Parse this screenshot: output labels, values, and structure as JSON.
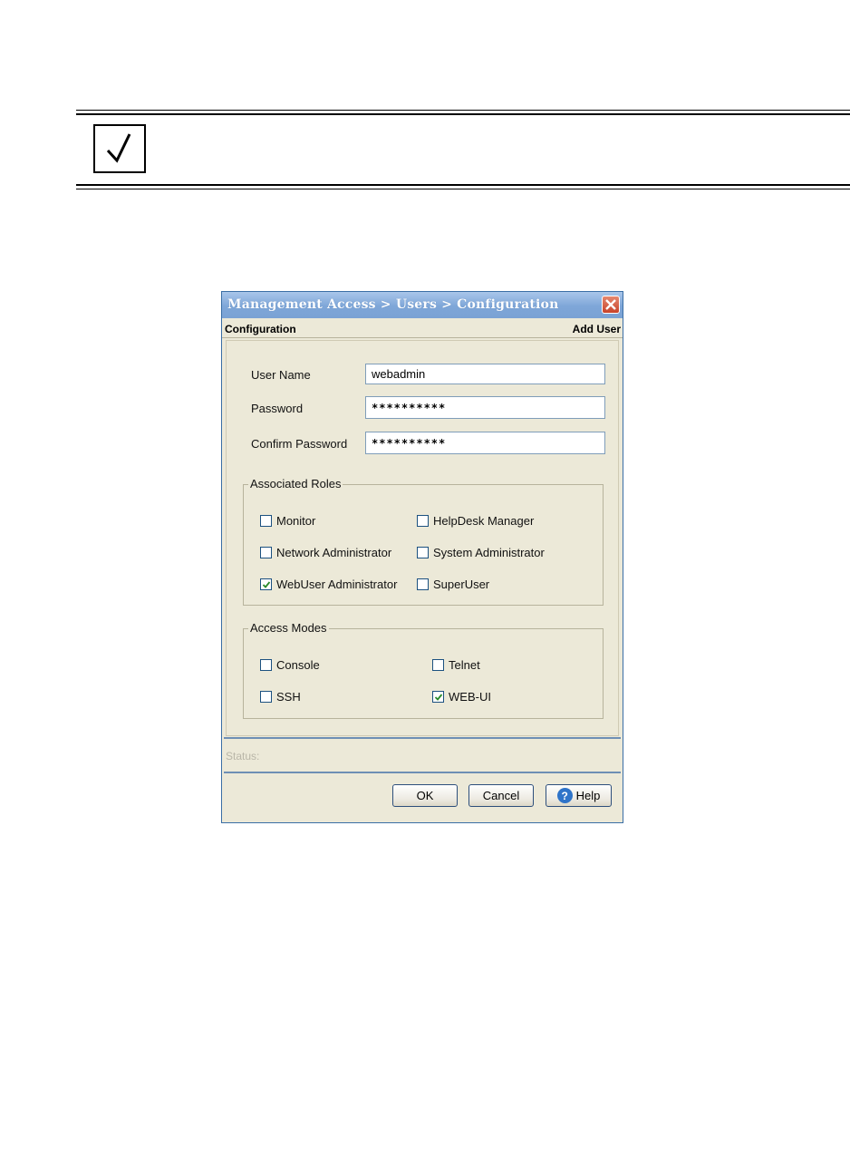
{
  "note": {
    "icon": "checkmark-icon"
  },
  "dialog": {
    "title": "Management Access > Users > Configuration",
    "header_left": "Configuration",
    "header_right": "Add User",
    "fields": {
      "username": {
        "label": "User Name",
        "value": "webadmin"
      },
      "password": {
        "label": "Password",
        "value": "**********"
      },
      "confirm": {
        "label": "Confirm Password",
        "value": "**********"
      }
    },
    "roles": {
      "title": "Associated Roles",
      "monitor": {
        "label": "Monitor",
        "checked": false
      },
      "helpdesk": {
        "label": "HelpDesk Manager",
        "checked": false
      },
      "netadmin": {
        "label": "Network Administrator",
        "checked": false
      },
      "sysadmin": {
        "label": "System Administrator",
        "checked": false
      },
      "webuser": {
        "label": "WebUser Administrator",
        "checked": true
      },
      "superuser": {
        "label": "SuperUser",
        "checked": false
      }
    },
    "modes": {
      "title": "Access Modes",
      "console": {
        "label": "Console",
        "checked": false
      },
      "telnet": {
        "label": "Telnet",
        "checked": false
      },
      "ssh": {
        "label": "SSH",
        "checked": false
      },
      "webui": {
        "label": "WEB-UI",
        "checked": true
      }
    },
    "status_label": "Status:",
    "buttons": {
      "ok": "OK",
      "cancel": "Cancel",
      "help": "Help"
    },
    "colors": {
      "title_bar": "#7ea6d8",
      "background": "#ece9d8",
      "check": "#2a8a2a"
    }
  }
}
